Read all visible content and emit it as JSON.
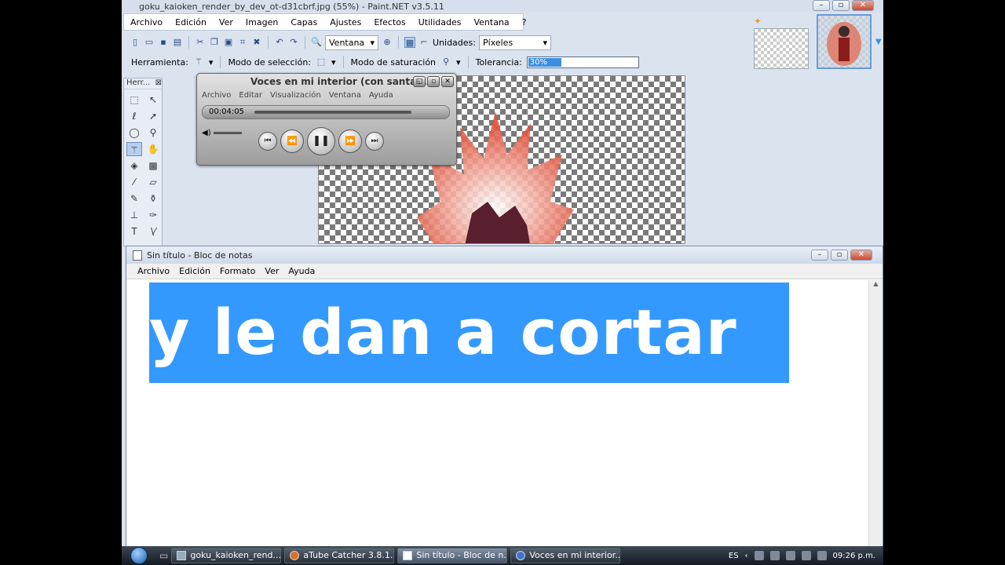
{
  "paintnet": {
    "title": "goku_kaioken_render_by_dev_ot-d31cbrf.jpg (55%) - Paint.NET v3.5.11",
    "menu": [
      "Archivo",
      "Edición",
      "Ver",
      "Imagen",
      "Capas",
      "Ajustes",
      "Efectos",
      "Utilidades",
      "Ventana",
      "?"
    ],
    "zoom_value": "Ventana",
    "units_label": "Unidades:",
    "units_value": "Píxeles",
    "tool_label": "Herramienta:",
    "selection_mode_label": "Modo de selección:",
    "flood_mode_label": "Modo de saturación",
    "tolerance_label": "Tolerancia:",
    "tolerance_value": "30%",
    "tolerance_fraction": 0.3,
    "tools_panel_title": "Herr..."
  },
  "media_player": {
    "title": "Voces en mi interior (con santa...",
    "menu": [
      "Archivo",
      "Editar",
      "Visualización",
      "Ventana",
      "Ayuda"
    ],
    "time": "00:04:05"
  },
  "notepad": {
    "title": "Sin título - Bloc de notas",
    "menu": [
      "Archivo",
      "Edición",
      "Formato",
      "Ver",
      "Ayuda"
    ],
    "selected_text": "y le dan a cortar"
  },
  "taskbar": {
    "items": [
      "goku_kaioken_rend...",
      "aTube Catcher 3.8.1...",
      "Sin título - Bloc de n...",
      "Voces en mi interior..."
    ],
    "language": "ES",
    "clock": "09:26 p.m."
  },
  "colors": {
    "selection": "#3399ff",
    "taskbar": "#1f2530"
  }
}
